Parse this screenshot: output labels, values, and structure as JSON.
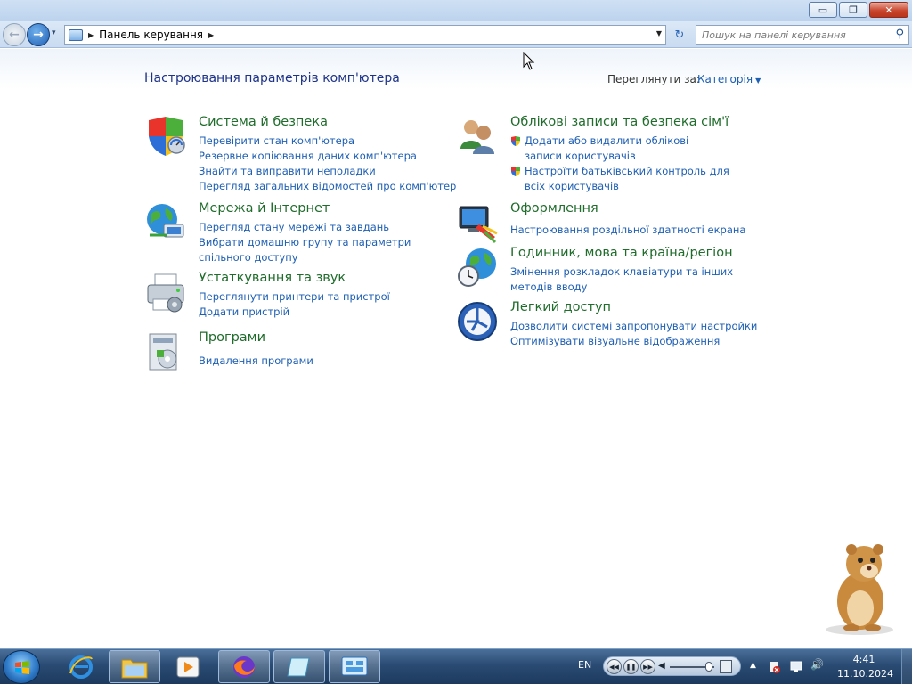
{
  "window": {
    "min_glyph": "▭",
    "max_glyph": "❐",
    "close_glyph": "✕"
  },
  "nav": {
    "back_glyph": "←",
    "forward_glyph": "→",
    "recent_glyph": "▾",
    "breadcrumb_arrow": "▶",
    "breadcrumb": "Панель керування",
    "address_dropdown": "▼",
    "refresh_glyph": "↻",
    "search_placeholder": "Пошук на панелі керування",
    "search_icon": "⚲"
  },
  "content": {
    "page_title": "Настроювання параметрів комп'ютера",
    "view_by_label": "Переглянути за:",
    "view_by_value": "Категорія",
    "view_by_caret": "▼"
  },
  "categories": [
    {
      "icon": "shield-security-icon",
      "title": "Система й безпека",
      "links": [
        "Перевірити стан комп'ютера",
        "Резервне копіювання даних комп'ютера",
        "Знайти та виправити неполадки",
        "Перегляд загальних відомостей про комп'ютер"
      ]
    },
    {
      "icon": "network-globe-icon",
      "title": "Мережа й Інтернет",
      "links": [
        "Перегляд стану мережі та завдань",
        "Вибрати домашню групу та параметри спільного доступу"
      ]
    },
    {
      "icon": "printer-icon",
      "title": "Устаткування та звук",
      "links": [
        "Переглянути принтери та пристрої",
        "Додати пристрій"
      ]
    },
    {
      "icon": "programs-icon",
      "title": "Програми",
      "links": [
        "Видалення програми"
      ]
    },
    {
      "icon": "users-icon",
      "title": "Облікові записи та безпека сім'ї",
      "links": [
        "Додати або видалити облікові записи користувачів",
        "Настроїти батьківський контроль для всіх користувачів"
      ]
    },
    {
      "icon": "appearance-icon",
      "title": "Оформлення",
      "links": [
        "Настроювання роздільної здатності екрана"
      ]
    },
    {
      "icon": "clock-globe-icon",
      "title": "Годинник, мова та країна/регіон",
      "links": [
        "Змінення розкладок клавіатури та інших методів вводу"
      ]
    },
    {
      "icon": "ease-of-access-icon",
      "title": "Легкий доступ",
      "links": [
        "Дозволити системі запропонувати настройки",
        "Оптимізувати візуальне відображення"
      ]
    }
  ],
  "taskbar": {
    "language": "EN",
    "media_prev": "◀◀",
    "media_pause": "❚❚",
    "media_next": "▶▶",
    "media_volume": "◀",
    "tray_up": "▲",
    "tray_speaker": "🔊",
    "time": "4:41",
    "date": "11.10.2024"
  }
}
